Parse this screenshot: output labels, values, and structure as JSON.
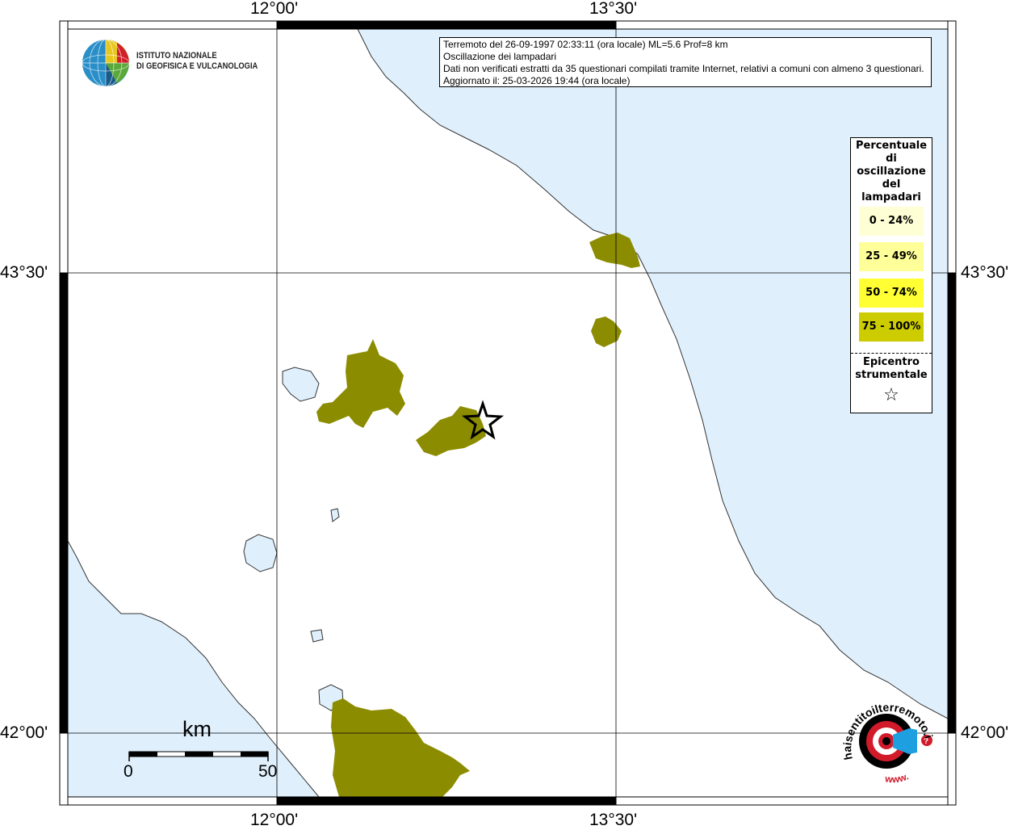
{
  "info": {
    "line1": "Terremoto del 26-09-1997 02:33:11 (ora locale) ML=5.6 Prof=8 km",
    "line2": "Oscillazione dei lampadari",
    "line3": "Dati non verificati estratti da 35 questionari compilati tramite Internet, relativi a comuni con almeno 3 questionari.",
    "line4": "Aggiornato il: 25-03-2026 19:44 (ora locale)"
  },
  "axes": {
    "top_left_lon": "12°00'",
    "top_right_lon": "13°30'",
    "bottom_left_lon": "12°00'",
    "bottom_right_lon": "13°30'",
    "left_top_lat": "43°30'",
    "left_bottom_lat": "42°00'",
    "right_top_lat": "43°30'",
    "right_bottom_lat": "42°00'"
  },
  "legend": {
    "title_lines": [
      "Percentuale",
      "di",
      "oscillazione",
      "del",
      "lampadari"
    ],
    "classes": [
      {
        "label": "0 - 24%",
        "color": "#ffffd6"
      },
      {
        "label": "25 - 49%",
        "color": "#ffff99"
      },
      {
        "label": "50 - 74%",
        "color": "#ffff33"
      },
      {
        "label": "75 - 100%",
        "color": "#cccc00"
      }
    ],
    "epicenter_line1": "Epicentro",
    "epicenter_line2": "strumentale",
    "epicenter_symbol": "☆"
  },
  "scale_bar": {
    "unit": "km",
    "start": "0",
    "end": "50"
  },
  "logos": {
    "ingv_line1": "ISTITUTO NAZIONALE",
    "ingv_line2": "DI GEOFISICA E VULCANOLOGIA",
    "hsit_text": "haisentitoilterremoto.it",
    "hsit_www": "www."
  },
  "colors": {
    "sea": "#dff0fc",
    "land": "#ffffff",
    "municipality_fill": "#8c8c00",
    "frame": "#000000"
  }
}
